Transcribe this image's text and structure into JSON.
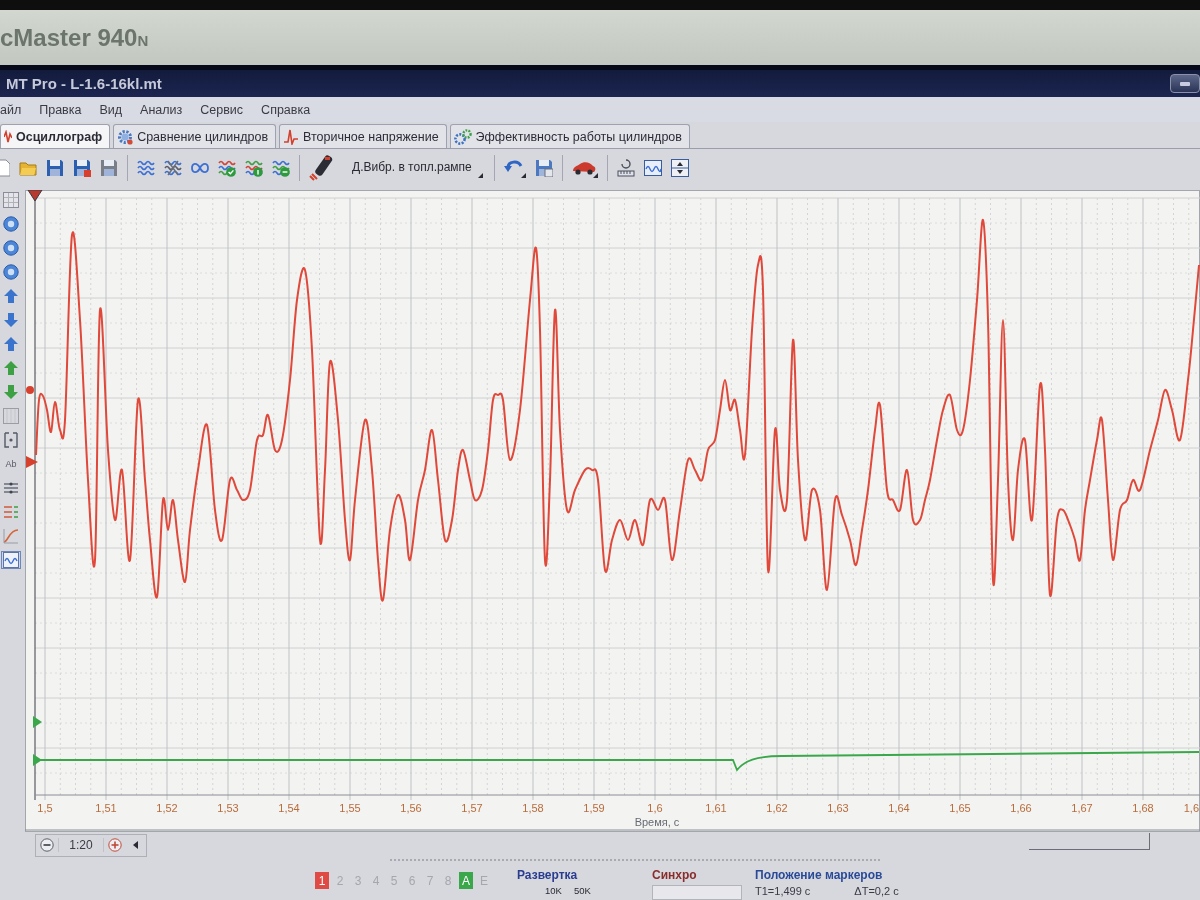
{
  "bezel": {
    "label": "cMaster 940$_{N}$"
  },
  "window": {
    "title": "MT Pro - L-1.6-16kl.mt"
  },
  "menu": [
    "айл",
    "Правка",
    "Вид",
    "Анализ",
    "Сервис",
    "Справка"
  ],
  "tabs": [
    {
      "label": "Осциллограф",
      "selected": true
    },
    {
      "label": "Сравнение цилиндров",
      "selected": false
    },
    {
      "label": "Вторичное напряжение",
      "selected": false
    },
    {
      "label": "Эффективность работы цилиндров",
      "selected": false
    }
  ],
  "toolbar": {
    "sensor_dropdown": "Д.Вибр. в топл.рампе"
  },
  "left_tools": [
    {
      "selected": false
    },
    {
      "selected": false
    },
    {
      "selected": false
    },
    {
      "selected": false
    },
    {
      "selected": false
    },
    {
      "selected": false
    },
    {
      "selected": false
    },
    {
      "selected": false
    },
    {
      "selected": false
    },
    {
      "selected": false
    },
    {
      "selected": false
    },
    {
      "label": "Ab",
      "selected": false
    },
    {
      "selected": false
    },
    {
      "selected": false
    },
    {
      "selected": false
    },
    {
      "selected": true
    }
  ],
  "plot": {
    "x_ticks": [
      "1,5",
      "1,51",
      "1,52",
      "1,53",
      "1,54",
      "1,55",
      "1,56",
      "1,57",
      "1,58",
      "1,59",
      "1,6",
      "1,61",
      "1,62",
      "1,63",
      "1,64",
      "1,65",
      "1,66",
      "1,67",
      "1,68",
      "1,6"
    ],
    "x_label": "Время, с"
  },
  "zoom": {
    "scale": "1:20"
  },
  "channels": [
    {
      "label": "1",
      "on": true,
      "color": "#e04a44"
    },
    {
      "label": "2",
      "on": false
    },
    {
      "label": "3",
      "on": false
    },
    {
      "label": "4",
      "on": false
    },
    {
      "label": "5",
      "on": false
    },
    {
      "label": "6",
      "on": false
    },
    {
      "label": "7",
      "on": false
    },
    {
      "label": "8",
      "on": false
    },
    {
      "label": "A",
      "on": true,
      "color": "#3aa84a"
    },
    {
      "label": "E",
      "on": false
    }
  ],
  "sweep": {
    "title": "Развертка",
    "options": [
      "10K",
      "50K"
    ]
  },
  "sync": {
    "title": "Синхро"
  },
  "markers": {
    "title": "Положение маркеров",
    "t1": "T1=1,499 c",
    "delta_t": "ΔT=0,2 c"
  }
}
